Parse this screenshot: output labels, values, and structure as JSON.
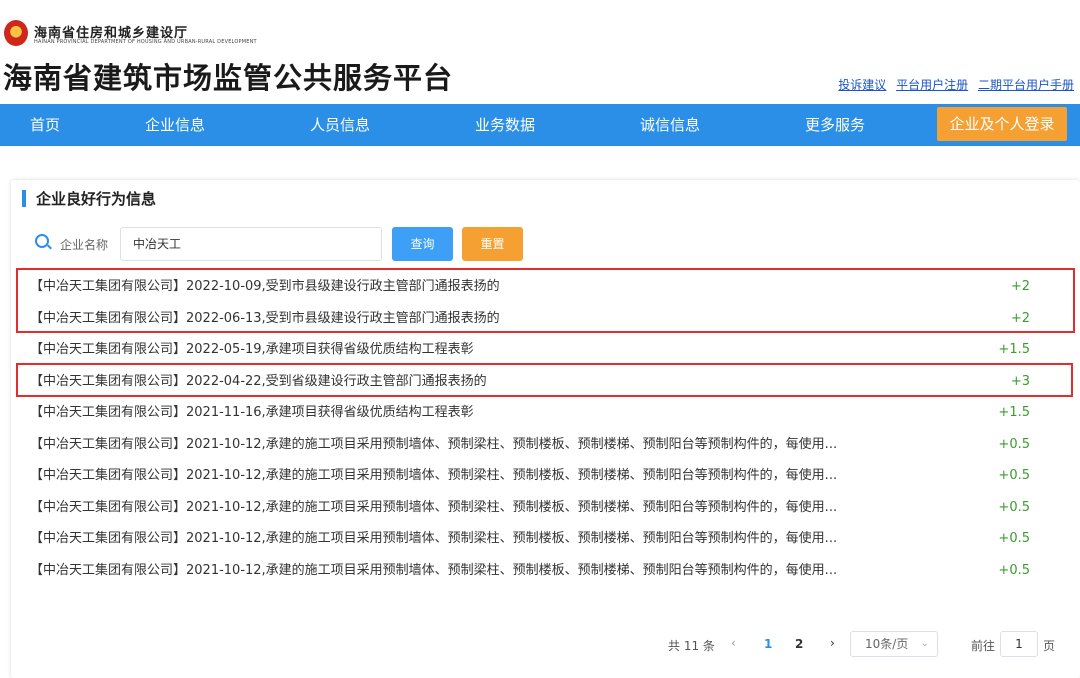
{
  "header": {
    "dept_name": "海南省住房和城乡建设厅",
    "dept_en": "HAINAN PROVINCIAL DEPARTMENT OF HOUSING AND URBAN-RURAL DEVELOPMENT",
    "site_title": "海南省建筑市场监管公共服务平台",
    "links": [
      "投诉建议",
      "平台用户注册",
      "二期平台用户手册"
    ]
  },
  "nav": {
    "items": [
      "首页",
      "企业信息",
      "人员信息",
      "业务数据",
      "诚信信息",
      "更多服务"
    ],
    "login": "企业及个人登录"
  },
  "panel": {
    "title": "企业良好行为信息",
    "search": {
      "label": "企业名称",
      "value": "中冶天工",
      "query_btn": "查询",
      "reset_btn": "重置"
    }
  },
  "records": [
    {
      "text": "【中冶天工集团有限公司】2022-10-09,受到市县级建设行政主管部门通报表扬的",
      "score": "+2"
    },
    {
      "text": "【中冶天工集团有限公司】2022-06-13,受到市县级建设行政主管部门通报表扬的",
      "score": "+2"
    },
    {
      "text": "【中冶天工集团有限公司】2022-05-19,承建项目获得省级优质结构工程表彰",
      "score": "+1.5"
    },
    {
      "text": "【中冶天工集团有限公司】2022-04-22,受到省级建设行政主管部门通报表扬的",
      "score": "+3"
    },
    {
      "text": "【中冶天工集团有限公司】2021-11-16,承建项目获得省级优质结构工程表彰",
      "score": "+1.5"
    },
    {
      "text": "【中冶天工集团有限公司】2021-10-12,承建的施工项目采用预制墙体、预制梁柱、预制楼板、预制楼梯、预制阳台等预制构件的，每使用...",
      "score": "+0.5"
    },
    {
      "text": "【中冶天工集团有限公司】2021-10-12,承建的施工项目采用预制墙体、预制梁柱、预制楼板、预制楼梯、预制阳台等预制构件的，每使用...",
      "score": "+0.5"
    },
    {
      "text": "【中冶天工集团有限公司】2021-10-12,承建的施工项目采用预制墙体、预制梁柱、预制楼板、预制楼梯、预制阳台等预制构件的，每使用...",
      "score": "+0.5"
    },
    {
      "text": "【中冶天工集团有限公司】2021-10-12,承建的施工项目采用预制墙体、预制梁柱、预制楼板、预制楼梯、预制阳台等预制构件的，每使用...",
      "score": "+0.5"
    },
    {
      "text": "【中冶天工集团有限公司】2021-10-12,承建的施工项目采用预制墙体、预制梁柱、预制楼板、预制楼梯、预制阳台等预制构件的，每使用...",
      "score": "+0.5"
    }
  ],
  "pagination": {
    "total": "共 11 条",
    "prev": "‹",
    "pages": [
      "1",
      "2"
    ],
    "next": "›",
    "page_size": "10条/页",
    "goto_label": "前往",
    "goto_value": "1",
    "page_unit": "页"
  },
  "colors": {
    "nav_blue": "#2b8fe8",
    "login_orange": "#f5a033",
    "score_green": "#3a9d2d",
    "highlight_red": "#e32d2d"
  }
}
